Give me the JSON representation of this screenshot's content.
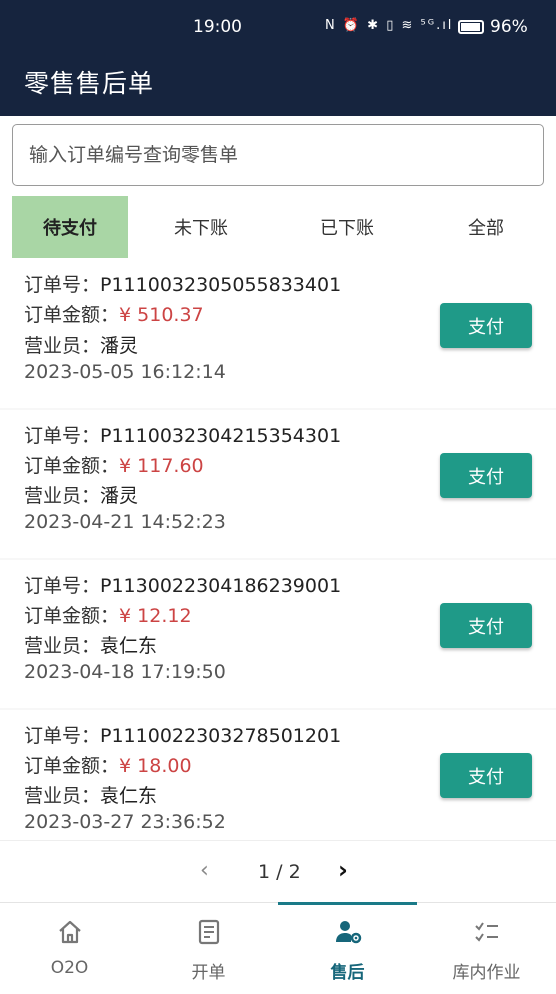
{
  "status_bar": {
    "time": "19:00",
    "icons_text": "N ⏰ ✱ ▯ ≋ ⁵ᴳ.ıl",
    "battery": "96%"
  },
  "app_bar": {
    "title": "零售售后单"
  },
  "search": {
    "placeholder": "输入订单编号查询零售单",
    "value": ""
  },
  "tabs": [
    {
      "label": "待支付",
      "active": true
    },
    {
      "label": "未下账",
      "active": false
    },
    {
      "label": "已下账",
      "active": false
    },
    {
      "label": "全部",
      "active": false
    }
  ],
  "labels": {
    "order_no": "订单号：",
    "amount": "订单金额：",
    "clerk": "营业员：",
    "pay": "支付"
  },
  "orders": [
    {
      "order_no": "P1110032305055833401",
      "amount": "¥ 510.37",
      "clerk": "潘灵",
      "time": "2023-05-05 16:12:14"
    },
    {
      "order_no": "P1110032304215354301",
      "amount": "¥ 117.60",
      "clerk": "潘灵",
      "time": "2023-04-21 14:52:23"
    },
    {
      "order_no": "P1130022304186239001",
      "amount": "¥ 12.12",
      "clerk": "袁仁东",
      "time": "2023-04-18 17:19:50"
    },
    {
      "order_no": "P1110022303278501201",
      "amount": "¥ 18.00",
      "clerk": "袁仁东",
      "time": "2023-03-27 23:36:52"
    }
  ],
  "pagination": {
    "text": "1 / 2",
    "current": 1,
    "total": 2
  },
  "bottom_nav": [
    {
      "label": "O2O",
      "icon": "home-icon"
    },
    {
      "label": "开单",
      "icon": "receipt-icon"
    },
    {
      "label": "售后",
      "icon": "user-settings-icon",
      "active": true
    },
    {
      "label": "库内作业",
      "icon": "checklist-icon"
    }
  ],
  "colors": {
    "header_bg": "#16243e",
    "active_tab_bg": "#a9d6a5",
    "amount": "#cc4444",
    "pay_button": "#1f9a88",
    "nav_active": "#16667a"
  }
}
